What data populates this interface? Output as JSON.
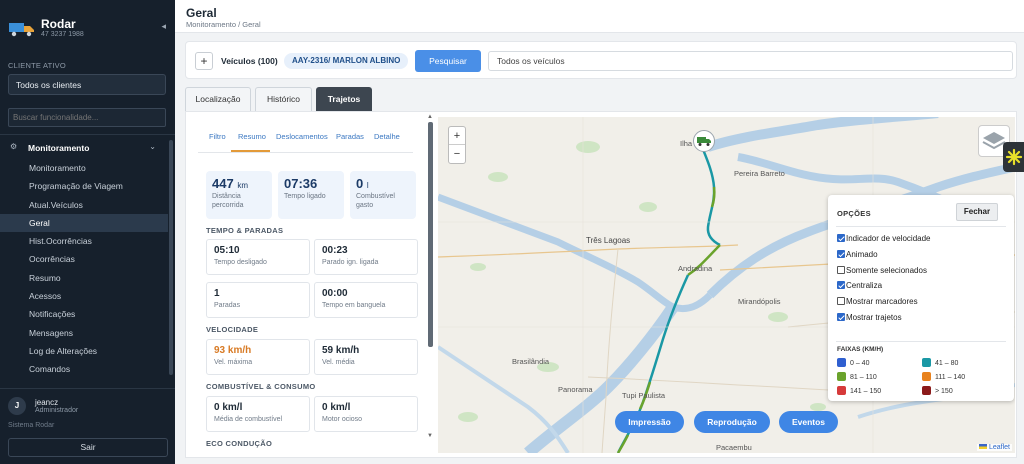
{
  "sidebar": {
    "brand_name": "Rodar",
    "brand_phone": "47 3237 1988",
    "collapse_icon": "◂",
    "client_label": "CLIENTE ATIVO",
    "client_value": "Todos os clientes",
    "search_placeholder": "Buscar funcionalidade...",
    "group_label": "Monitoramento",
    "items": [
      {
        "label": "Monitoramento"
      },
      {
        "label": "Programação de Viagem"
      },
      {
        "label": "Atual.Veículos"
      },
      {
        "label": "Geral"
      },
      {
        "label": "Hist.Ocorrências"
      },
      {
        "label": "Ocorrências"
      },
      {
        "label": "Resumo"
      },
      {
        "label": "Acessos"
      },
      {
        "label": "Notificações"
      },
      {
        "label": "Mensagens"
      },
      {
        "label": "Log de Alterações"
      },
      {
        "label": "Comandos"
      }
    ],
    "user_initial": "J",
    "user_name": "jeancz",
    "user_role": "Administrador",
    "system_label": "Sistema Rodar",
    "logout_label": "Sair"
  },
  "header": {
    "title": "Geral",
    "breadcrumb": "Monitoramento / Geral"
  },
  "vehicle_bar": {
    "add_label": "+",
    "vehicles_label": "Veículos (100)",
    "selected_chip": "AAY-2316/ MARLON ALBINO",
    "search_button": "Pesquisar",
    "all_vehicles_value": "Todos os veículos"
  },
  "tabs": [
    {
      "label": "Localização"
    },
    {
      "label": "Histórico"
    },
    {
      "label": "Trajetos"
    }
  ],
  "subtabs": [
    {
      "label": "Filtro"
    },
    {
      "label": "Resumo"
    },
    {
      "label": "Deslocamentos"
    },
    {
      "label": "Paradas"
    },
    {
      "label": "Detalhe"
    }
  ],
  "kpis": [
    {
      "value": "447",
      "unit": "km",
      "label": "Distância percorrida"
    },
    {
      "value": "07:36",
      "unit": "",
      "label": "Tempo ligado"
    },
    {
      "value": "0",
      "unit": "l",
      "label": "Combustível gasto"
    }
  ],
  "sections": {
    "time_stops": {
      "title": "TEMPO & PARADAS",
      "cards": [
        {
          "value": "05:10",
          "label": "Tempo desligado"
        },
        {
          "value": "00:23",
          "label": "Parado ign. ligada"
        },
        {
          "value": "1",
          "label": "Paradas"
        },
        {
          "value": "00:00",
          "label": "Tempo em banguela"
        }
      ]
    },
    "speed": {
      "title": "VELOCIDADE",
      "cards": [
        {
          "value": "93 km/h",
          "label": "Vel. máxima"
        },
        {
          "value": "59 km/h",
          "label": "Vel. média"
        }
      ]
    },
    "fuel": {
      "title": "COMBUSTÍVEL & CONSUMO",
      "cards": [
        {
          "value": "0 km/l",
          "label": "Média de combustível"
        },
        {
          "value": "0 km/l",
          "label": "Motor ocioso"
        }
      ]
    },
    "eco": {
      "title": "ECO CONDUÇÃO"
    }
  },
  "map": {
    "zoom_in": "+",
    "zoom_out": "−",
    "places": {
      "tres_lagoas": "Três Lagoas",
      "pereira_barreto": "Pereira Barreto",
      "andradina": "Andradina",
      "mirandopolis": "Mirandópolis",
      "brasilandia": "Brasilândia",
      "panorama": "Panorama",
      "tupi_paulista": "Tupi Paulista",
      "ilha": "Ilha",
      "pacaembu": "Pacaembu"
    },
    "attribution": "Leaflet",
    "action_buttons": [
      {
        "label": "Impressão"
      },
      {
        "label": "Reprodução"
      },
      {
        "label": "Eventos"
      }
    ],
    "options": {
      "title": "OPÇÕES",
      "close_label": "Fechar",
      "checks": [
        {
          "label": "Indicador de velocidade",
          "checked": true
        },
        {
          "label": "Animado",
          "checked": true
        },
        {
          "label": "Somente selecionados",
          "checked": false
        },
        {
          "label": "Centraliza",
          "checked": true
        },
        {
          "label": "Mostrar marcadores",
          "checked": false
        },
        {
          "label": "Mostrar trajetos",
          "checked": true
        }
      ],
      "bands_title": "FAIXAS (KM/H)",
      "bands": [
        {
          "label": "0 – 40",
          "color": "#2f5fd0"
        },
        {
          "label": "41 – 80",
          "color": "#1a98a5"
        },
        {
          "label": "81 – 110",
          "color": "#6aa32c"
        },
        {
          "label": "111 – 140",
          "color": "#e8821e"
        },
        {
          "label": "141 – 150",
          "color": "#d63a3a"
        },
        {
          "label": "> 150",
          "color": "#8b1a1a"
        }
      ]
    }
  },
  "colors": {
    "sidebar_bg": "#16202c",
    "accent": "#4a8fe7",
    "route_teal": "#1a98a5",
    "route_green": "#6aa32c"
  }
}
